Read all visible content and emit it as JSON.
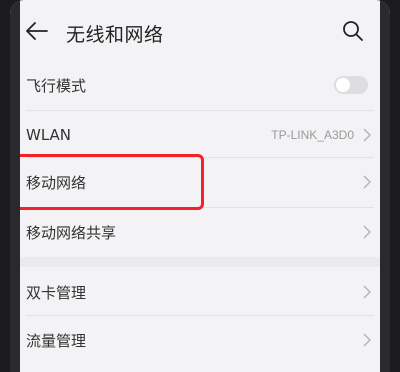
{
  "header": {
    "back_icon": "back-arrow-icon",
    "title": "无线和网络",
    "search_icon": "search-icon"
  },
  "settings": {
    "airplane": {
      "label": "飞行模式",
      "toggle_on": false
    },
    "wlan": {
      "label": "WLAN",
      "value": "TP-LINK_A3D0"
    },
    "mobile_network": {
      "label": "移动网络"
    },
    "tethering": {
      "label": "移动网络共享"
    },
    "dual_sim": {
      "label": "双卡管理"
    },
    "data_usage": {
      "label": "流量管理"
    }
  },
  "colors": {
    "highlight": "#f4202a",
    "background": "#f3f3f5"
  }
}
